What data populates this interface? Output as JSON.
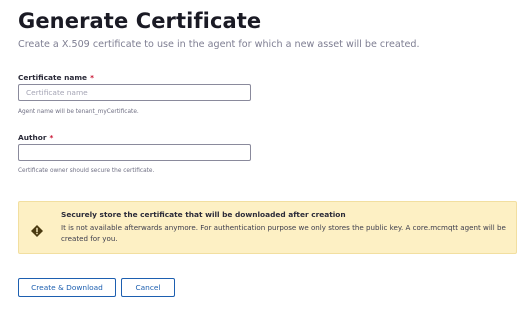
{
  "header": {
    "title": "Generate Certificate",
    "subtitle": "Create a X.509 certificate to use in the agent for which a new asset will be created."
  },
  "form": {
    "certificate_name": {
      "label": "Certificate name",
      "required_mark": "*",
      "value": "",
      "placeholder": "Certificate name",
      "helper": "Agent name will be tenant_myCertificate."
    },
    "author": {
      "label": "Author",
      "required_mark": "*",
      "value": "",
      "placeholder": "",
      "helper": "Certificate owner should secure the certificate."
    }
  },
  "warning": {
    "icon": "warning-diamond-icon",
    "title": "Securely store the certificate that will be downloaded after creation",
    "body": "It is not available afterwards anymore. For authentication purpose we only stores the public key. A core.mcmqtt agent will be created for you."
  },
  "actions": {
    "create_label": "Create & Download",
    "cancel_label": "Cancel"
  },
  "colors": {
    "accent": "#1d5fb0",
    "required": "#c8102e",
    "warning_bg": "#fdf0c4",
    "warning_icon": "#4a3a10"
  }
}
